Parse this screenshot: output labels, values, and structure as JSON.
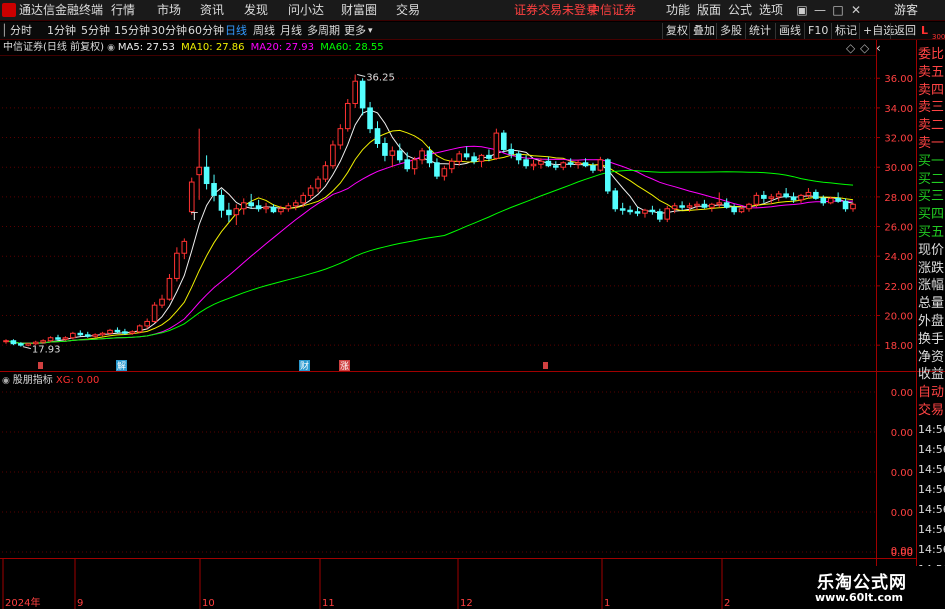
{
  "app": {
    "title": "通达信金融终端",
    "warning": "证券交易未登录",
    "broker": "中信证券",
    "guest": "游客"
  },
  "menu": [
    "行情",
    "市场",
    "资讯",
    "发现",
    "问小达",
    "财富圈",
    "交易"
  ],
  "right_menu": [
    "功能",
    "版面",
    "公式",
    "选项"
  ],
  "toolbar": {
    "periods": [
      "分时",
      "1分钟",
      "5分钟",
      "15分钟",
      "30分钟",
      "60分钟",
      "日线",
      "周线",
      "月线",
      "多周期",
      "更多"
    ],
    "active_period": "日线",
    "right_buttons": [
      "复权",
      "叠加",
      "多股",
      "统计",
      "画线",
      "F10",
      "标记",
      "+自选",
      "返回"
    ]
  },
  "chart_header": {
    "stock": "中信证券(日线 前复权)",
    "ma": [
      {
        "label": "MA5: 27.53",
        "color": "#f0f0f0"
      },
      {
        "label": "MA10: 27.86",
        "color": "#f0f000"
      },
      {
        "label": "MA20: 27.93",
        "color": "#ff00ff"
      },
      {
        "label": "MA60: 28.55",
        "color": "#00ff00"
      }
    ]
  },
  "indicator": {
    "name": "股朋指标",
    "value_label": "XG: 0.00"
  },
  "side_labels": [
    "委比",
    "卖五",
    "卖四",
    "卖三",
    "卖二",
    "卖一",
    "买一",
    "买二",
    "买三",
    "买四",
    "买五",
    "现价",
    "涨跌",
    "涨幅",
    "总量",
    "外盘",
    "换手",
    "净资",
    "收益",
    "自动",
    "交易"
  ],
  "time_labels": [
    "14:56",
    "14:56",
    "14:56",
    "14:56",
    "14:56",
    "14:56",
    "14:56",
    "14:56"
  ],
  "level": {
    "label": "L",
    "sub": "300"
  },
  "watermark": {
    "line1": "乐淘公式网",
    "line2": "www.60lt.com"
  },
  "chart_data": {
    "type": "candlestick",
    "y_ticks": [
      "36.00",
      "34.00",
      "32.00",
      "30.00",
      "28.00",
      "26.00",
      "24.00",
      "22.00",
      "20.00",
      "18.00"
    ],
    "indicator_ticks": [
      "0.00",
      "0.00",
      "0.00",
      "0.00",
      "0.00",
      "0.00"
    ],
    "x_labels": [
      "2024年",
      "9",
      "10",
      "11",
      "12",
      "1",
      "2"
    ],
    "annotations": {
      "high": "36.25",
      "low": "17.93",
      "markers": [
        "解",
        "财",
        "涨"
      ],
      "t_mark": "T"
    },
    "ylim": [
      17.0,
      37.5
    ],
    "candles": [
      [
        18.3,
        18.4,
        18.1,
        18.3
      ],
      [
        18.3,
        18.4,
        18.0,
        18.1
      ],
      [
        18.1,
        18.2,
        17.9,
        18.0
      ],
      [
        18.0,
        18.1,
        17.93,
        18.1
      ],
      [
        18.1,
        18.3,
        18.0,
        18.2
      ],
      [
        18.2,
        18.4,
        18.1,
        18.3
      ],
      [
        18.3,
        18.6,
        18.2,
        18.5
      ],
      [
        18.5,
        18.7,
        18.3,
        18.4
      ],
      [
        18.4,
        18.6,
        18.3,
        18.5
      ],
      [
        18.5,
        18.9,
        18.4,
        18.8
      ],
      [
        18.8,
        19.0,
        18.6,
        18.7
      ],
      [
        18.7,
        18.9,
        18.5,
        18.6
      ],
      [
        18.6,
        18.8,
        18.5,
        18.7
      ],
      [
        18.7,
        18.9,
        18.6,
        18.8
      ],
      [
        18.8,
        19.1,
        18.7,
        19.0
      ],
      [
        19.0,
        19.2,
        18.8,
        18.9
      ],
      [
        18.9,
        19.1,
        18.7,
        18.8
      ],
      [
        18.8,
        19.0,
        18.7,
        18.9
      ],
      [
        18.9,
        19.4,
        18.8,
        19.3
      ],
      [
        19.3,
        19.8,
        19.1,
        19.6
      ],
      [
        19.6,
        20.9,
        19.5,
        20.7
      ],
      [
        20.7,
        21.4,
        20.5,
        21.1
      ],
      [
        21.1,
        22.8,
        21.0,
        22.5
      ],
      [
        22.5,
        24.6,
        22.3,
        24.2
      ],
      [
        24.2,
        25.2,
        23.8,
        25.0
      ],
      [
        27.0,
        29.3,
        26.8,
        29.0
      ],
      [
        29.5,
        32.6,
        27.8,
        30.0
      ],
      [
        30.0,
        30.8,
        28.5,
        28.9
      ],
      [
        28.9,
        29.5,
        27.7,
        28.1
      ],
      [
        28.1,
        28.5,
        26.6,
        27.1
      ],
      [
        27.1,
        27.6,
        26.3,
        26.8
      ],
      [
        26.8,
        27.5,
        26.1,
        27.2
      ],
      [
        27.2,
        27.9,
        26.8,
        27.6
      ],
      [
        27.6,
        28.2,
        27.2,
        27.4
      ],
      [
        27.4,
        27.8,
        27.0,
        27.2
      ],
      [
        27.2,
        27.6,
        26.9,
        27.3
      ],
      [
        27.3,
        27.5,
        26.9,
        27.0
      ],
      [
        27.0,
        27.4,
        26.8,
        27.2
      ],
      [
        27.2,
        27.6,
        27.0,
        27.4
      ],
      [
        27.4,
        27.8,
        27.1,
        27.6
      ],
      [
        27.6,
        28.3,
        27.3,
        28.1
      ],
      [
        28.1,
        28.8,
        27.9,
        28.6
      ],
      [
        28.6,
        29.4,
        28.3,
        29.2
      ],
      [
        29.2,
        30.4,
        29.0,
        30.1
      ],
      [
        30.1,
        31.8,
        29.9,
        31.5
      ],
      [
        31.5,
        32.9,
        31.2,
        32.6
      ],
      [
        32.6,
        34.6,
        32.4,
        34.3
      ],
      [
        34.3,
        36.25,
        34.0,
        35.8
      ],
      [
        35.8,
        36.0,
        33.5,
        34.0
      ],
      [
        34.0,
        34.4,
        32.3,
        32.6
      ],
      [
        32.6,
        33.1,
        31.3,
        31.6
      ],
      [
        31.6,
        32.0,
        30.4,
        30.8
      ],
      [
        30.8,
        31.4,
        30.0,
        31.1
      ],
      [
        31.1,
        31.6,
        30.3,
        30.5
      ],
      [
        30.5,
        31.0,
        29.7,
        29.9
      ],
      [
        29.9,
        30.7,
        29.5,
        30.5
      ],
      [
        30.5,
        31.3,
        30.2,
        31.1
      ],
      [
        31.1,
        31.4,
        30.0,
        30.3
      ],
      [
        30.3,
        30.6,
        29.2,
        29.4
      ],
      [
        29.4,
        30.1,
        29.1,
        29.9
      ],
      [
        29.9,
        30.6,
        29.6,
        30.4
      ],
      [
        30.4,
        31.1,
        30.1,
        30.9
      ],
      [
        30.9,
        31.4,
        30.5,
        30.7
      ],
      [
        30.7,
        31.0,
        30.2,
        30.4
      ],
      [
        30.4,
        30.9,
        30.0,
        30.8
      ],
      [
        30.8,
        31.2,
        30.4,
        30.6
      ],
      [
        30.6,
        32.6,
        30.5,
        32.3
      ],
      [
        32.3,
        32.5,
        31.0,
        31.2
      ],
      [
        31.2,
        31.6,
        30.6,
        30.9
      ],
      [
        30.9,
        31.1,
        30.2,
        30.5
      ],
      [
        30.5,
        30.8,
        29.9,
        30.1
      ],
      [
        30.1,
        30.5,
        29.8,
        30.2
      ],
      [
        30.2,
        30.6,
        29.9,
        30.4
      ],
      [
        30.4,
        30.7,
        30.0,
        30.1
      ],
      [
        30.1,
        30.4,
        29.8,
        30.0
      ],
      [
        30.0,
        30.4,
        29.8,
        30.3
      ],
      [
        30.3,
        30.6,
        30.0,
        30.2
      ],
      [
        30.2,
        30.5,
        29.9,
        30.3
      ],
      [
        30.3,
        30.6,
        30.0,
        30.1
      ],
      [
        30.1,
        30.3,
        29.6,
        29.8
      ],
      [
        29.8,
        30.7,
        29.7,
        30.5
      ],
      [
        30.5,
        30.6,
        28.2,
        28.4
      ],
      [
        28.4,
        28.6,
        27.0,
        27.2
      ],
      [
        27.2,
        27.6,
        26.8,
        27.1
      ],
      [
        27.1,
        27.4,
        26.8,
        27.0
      ],
      [
        27.0,
        27.3,
        26.7,
        26.9
      ],
      [
        26.9,
        27.2,
        26.6,
        27.1
      ],
      [
        27.1,
        27.4,
        26.8,
        27.0
      ],
      [
        27.0,
        27.2,
        26.3,
        26.5
      ],
      [
        26.5,
        27.4,
        26.3,
        27.2
      ],
      [
        27.2,
        27.6,
        26.9,
        27.4
      ],
      [
        27.4,
        27.7,
        27.1,
        27.3
      ],
      [
        27.3,
        27.6,
        27.0,
        27.4
      ],
      [
        27.4,
        27.7,
        27.1,
        27.5
      ],
      [
        27.5,
        27.8,
        27.2,
        27.3
      ],
      [
        27.3,
        27.6,
        27.0,
        27.5
      ],
      [
        27.5,
        28.3,
        27.3,
        27.6
      ],
      [
        27.6,
        27.9,
        27.2,
        27.3
      ],
      [
        27.3,
        27.5,
        26.8,
        27.0
      ],
      [
        27.0,
        27.4,
        26.9,
        27.2
      ],
      [
        27.2,
        27.6,
        27.0,
        27.5
      ],
      [
        27.5,
        28.3,
        27.3,
        28.1
      ],
      [
        28.1,
        28.4,
        27.6,
        27.9
      ],
      [
        27.9,
        28.2,
        27.5,
        28.0
      ],
      [
        28.0,
        28.4,
        27.7,
        28.2
      ],
      [
        28.2,
        28.6,
        27.9,
        28.0
      ],
      [
        28.0,
        28.3,
        27.6,
        27.8
      ],
      [
        27.8,
        28.2,
        27.6,
        28.1
      ],
      [
        28.1,
        28.6,
        27.9,
        28.3
      ],
      [
        28.3,
        28.5,
        27.8,
        27.9
      ],
      [
        27.9,
        28.1,
        27.4,
        27.6
      ],
      [
        27.6,
        28.0,
        27.5,
        27.9
      ],
      [
        27.9,
        28.3,
        27.6,
        27.7
      ],
      [
        27.7,
        27.9,
        27.0,
        27.2
      ],
      [
        27.2,
        27.6,
        27.0,
        27.5
      ]
    ]
  }
}
